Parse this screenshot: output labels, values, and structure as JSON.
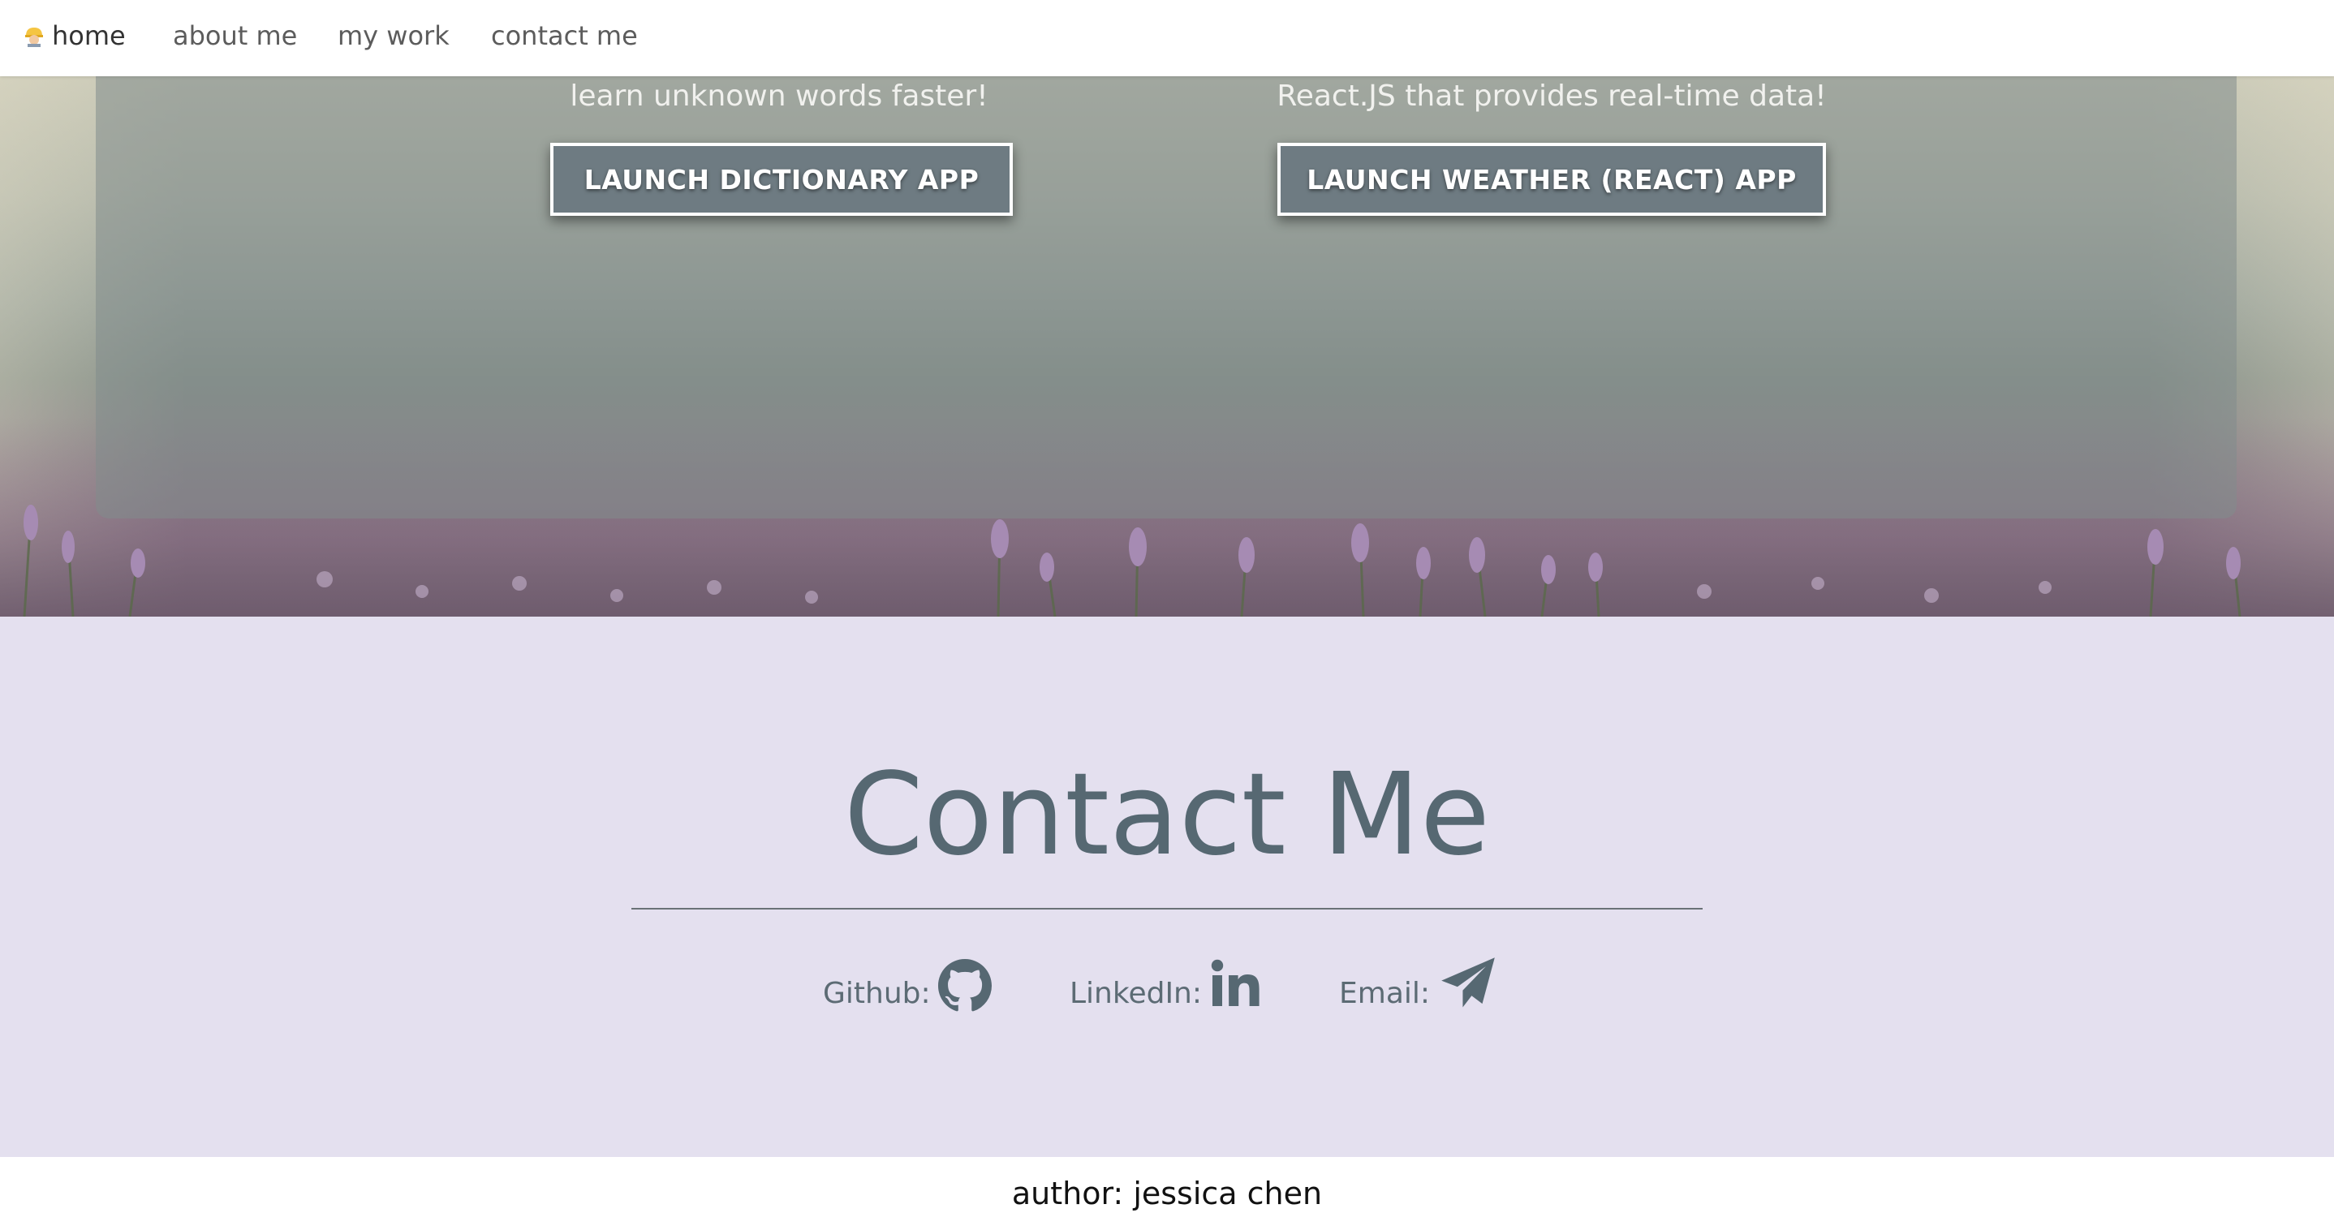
{
  "nav": {
    "home_icon": "construction-worker-emoji",
    "home_label": "home",
    "about_label": "about me",
    "work_label": "my work",
    "contact_label": "contact me"
  },
  "projects": {
    "dictionary": {
      "description": "learn unknown words faster!",
      "button_label": "LAUNCH DICTIONARY APP"
    },
    "weather": {
      "description": "React.JS that provides real-time data!",
      "button_label": "LAUNCH WEATHER (REACT) APP"
    }
  },
  "contact": {
    "title": "Contact Me",
    "github_label": "Github:",
    "github_icon": "github-icon",
    "linkedin_label": "LinkedIn:",
    "linkedin_icon": "linkedin-icon",
    "email_label": "Email:",
    "email_icon": "paper-plane-icon"
  },
  "footer": {
    "text": "author: jessica chen"
  },
  "colors": {
    "accent": "#566872",
    "contact_bg": "#e4e0ef",
    "button_bg": "#6e7b82"
  }
}
